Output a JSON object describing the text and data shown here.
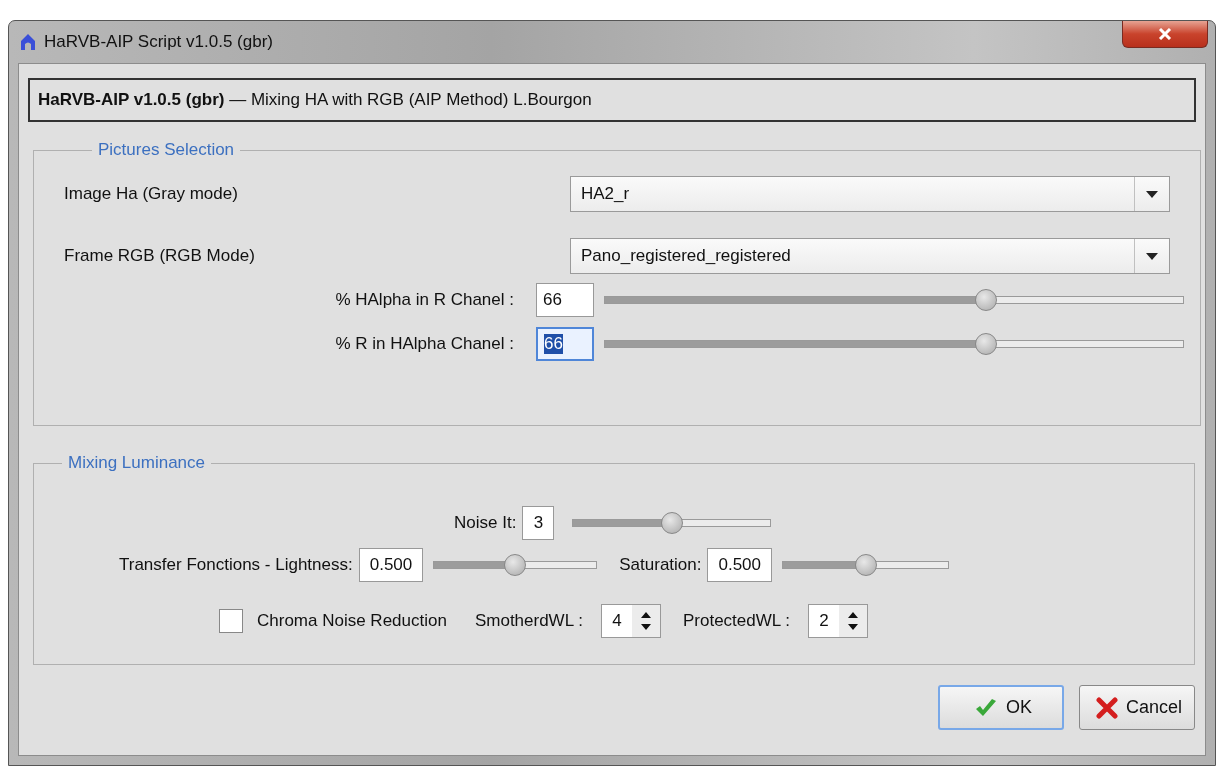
{
  "window": {
    "title": "HaRVB-AIP Script v1.0.5 (gbr)"
  },
  "header": {
    "text": "**HaRVB-AIP v1.0.5 (gbr)** — Mixing HA with RGB (AIP Method) L.Bourgon"
  },
  "pictures_selection": {
    "title": "Pictures Selection",
    "combos": [
      {
        "label": "Image Ha (Gray mode)",
        "value": "HA2_r"
      },
      {
        "label": "Frame RGB (RGB Mode)",
        "value": "Pano_registered_registered"
      }
    ],
    "sliders": [
      {
        "label": "% HAlpha in R Chanel :",
        "value": "66",
        "level": 0.66,
        "text_selected": false
      },
      {
        "label": "% R in HAlpha Chanel :",
        "value": "66",
        "level": 0.66,
        "text_selected": true
      }
    ]
  },
  "mixing_luminance": {
    "title": "Mixing Luminance",
    "noise": {
      "label": "Noise It:",
      "value": "3",
      "level": 0.5
    },
    "lightness": {
      "label": "Transfer Fonctions - Lightness:",
      "value": "0.500",
      "level": 0.5
    },
    "saturation": {
      "label": "Saturation:",
      "value": "0.500",
      "level": 0.5
    },
    "chroma": {
      "label": "Chroma Noise Reduction",
      "checked": false
    },
    "spinners": [
      {
        "label": "SmotherdWL :",
        "value": "4"
      },
      {
        "label": "ProtectedWL :",
        "value": "2"
      }
    ]
  },
  "buttons": [
    {
      "kind": "ok",
      "label": "OK",
      "default": true
    },
    {
      "kind": "cancel",
      "label": "Cancel",
      "default": false
    }
  ]
}
